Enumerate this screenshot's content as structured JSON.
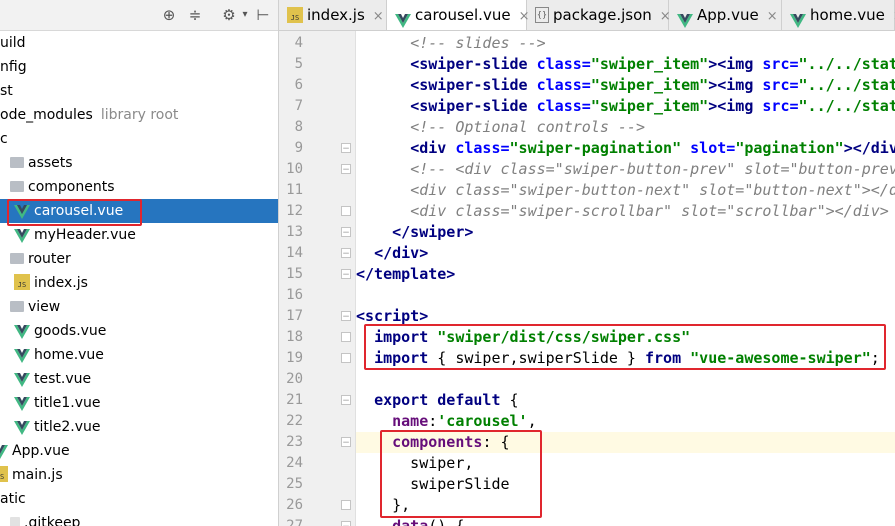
{
  "toolbar": {
    "icons": [
      "target-icon",
      "collapse-icon",
      "gear-icon",
      "pin-icon"
    ]
  },
  "tree": [
    {
      "label": "uild",
      "icon": "folder",
      "indent": 0
    },
    {
      "label": "nfig",
      "icon": "folder",
      "indent": 0
    },
    {
      "label": "st",
      "icon": "folder",
      "indent": 0
    },
    {
      "label": "ode_modules",
      "suffix": "library root",
      "icon": "folder",
      "indent": 0
    },
    {
      "label": "c",
      "icon": "folder",
      "indent": 0
    },
    {
      "label": "assets",
      "icon": "folder",
      "indent": 1
    },
    {
      "label": "components",
      "icon": "folder",
      "indent": 1
    },
    {
      "label": "carousel.vue",
      "icon": "vue",
      "indent": 2,
      "selected": true
    },
    {
      "label": "myHeader.vue",
      "icon": "vue",
      "indent": 2
    },
    {
      "label": "router",
      "icon": "folder",
      "indent": 1
    },
    {
      "label": "index.js",
      "icon": "js",
      "indent": 2
    },
    {
      "label": "view",
      "icon": "folder",
      "indent": 1
    },
    {
      "label": "goods.vue",
      "icon": "vue",
      "indent": 2
    },
    {
      "label": "home.vue",
      "icon": "vue",
      "indent": 2
    },
    {
      "label": "test.vue",
      "icon": "vue",
      "indent": 2
    },
    {
      "label": "title1.vue",
      "icon": "vue",
      "indent": 2
    },
    {
      "label": "title2.vue",
      "icon": "vue",
      "indent": 2
    },
    {
      "label": "App.vue",
      "icon": "vue",
      "indent": 0
    },
    {
      "label": "main.js",
      "icon": "js",
      "indent": 0
    },
    {
      "label": "atic",
      "icon": "folder",
      "indent": 0
    },
    {
      "label": ".gitkeep",
      "icon": "file",
      "indent": 1
    }
  ],
  "tabs": [
    {
      "label": "index.js",
      "icon": "js",
      "active": false
    },
    {
      "label": "carousel.vue",
      "icon": "vue",
      "active": true
    },
    {
      "label": "package.json",
      "icon": "json",
      "active": false
    },
    {
      "label": "App.vue",
      "icon": "vue",
      "active": false
    },
    {
      "label": "home.vue",
      "icon": "vue",
      "active": false
    }
  ],
  "tab_close": "×",
  "code_lines": [
    {
      "n": "4",
      "tokens": [
        [
          "plain",
          "      "
        ],
        [
          "cmt",
          "<!-- slides -->"
        ]
      ]
    },
    {
      "n": "5",
      "tokens": [
        [
          "plain",
          "      "
        ],
        [
          "tag",
          "<swiper-slide "
        ],
        [
          "attr",
          "class="
        ],
        [
          "str",
          "\"swiper_item\""
        ],
        [
          "tag",
          ">"
        ],
        [
          "tag",
          "<img "
        ],
        [
          "attr",
          "src="
        ],
        [
          "str",
          "\"../../static/"
        ]
      ]
    },
    {
      "n": "6",
      "tokens": [
        [
          "plain",
          "      "
        ],
        [
          "tag",
          "<swiper-slide "
        ],
        [
          "attr",
          "class="
        ],
        [
          "str",
          "\"swiper_item\""
        ],
        [
          "tag",
          ">"
        ],
        [
          "tag",
          "<img "
        ],
        [
          "attr",
          "src="
        ],
        [
          "str",
          "\"../../static/"
        ]
      ]
    },
    {
      "n": "7",
      "tokens": [
        [
          "plain",
          "      "
        ],
        [
          "tag",
          "<swiper-slide "
        ],
        [
          "attr",
          "class="
        ],
        [
          "str",
          "\"swiper_item\""
        ],
        [
          "tag",
          ">"
        ],
        [
          "tag",
          "<img "
        ],
        [
          "attr",
          "src="
        ],
        [
          "str",
          "\"../../static/"
        ]
      ]
    },
    {
      "n": "8",
      "tokens": [
        [
          "plain",
          "      "
        ],
        [
          "cmt",
          "<!-- Optional controls -->"
        ]
      ]
    },
    {
      "n": "9",
      "tokens": [
        [
          "plain",
          "      "
        ],
        [
          "tag",
          "<div "
        ],
        [
          "attr",
          "class="
        ],
        [
          "str",
          "\"swiper-pagination\""
        ],
        [
          "plain",
          " "
        ],
        [
          "attr",
          "slot="
        ],
        [
          "str",
          "\"pagination\""
        ],
        [
          "tag",
          "></div>"
        ]
      ]
    },
    {
      "n": "10",
      "tokens": [
        [
          "plain",
          "      "
        ],
        [
          "cmt",
          "<!-- <div class=\"swiper-button-prev\" slot=\"button-prev\"></div>"
        ]
      ]
    },
    {
      "n": "11",
      "tokens": [
        [
          "plain",
          "      "
        ],
        [
          "cmt",
          "<div class=\"swiper-button-next\" slot=\"button-next\"></div>"
        ]
      ]
    },
    {
      "n": "12",
      "tokens": [
        [
          "plain",
          "      "
        ],
        [
          "cmt",
          "<div class=\"swiper-scrollbar\" slot=\"scrollbar\"></div> -->"
        ]
      ]
    },
    {
      "n": "13",
      "tokens": [
        [
          "plain",
          "    "
        ],
        [
          "tag",
          "</swiper>"
        ]
      ]
    },
    {
      "n": "14",
      "tokens": [
        [
          "plain",
          "  "
        ],
        [
          "tag",
          "</div>"
        ]
      ]
    },
    {
      "n": "15",
      "tokens": [
        [
          "tag",
          "</template>"
        ]
      ]
    },
    {
      "n": "16",
      "tokens": []
    },
    {
      "n": "17",
      "tokens": [
        [
          "tag",
          "<script>"
        ]
      ]
    },
    {
      "n": "18",
      "tokens": [
        [
          "plain",
          "  "
        ],
        [
          "kw",
          "import "
        ],
        [
          "str",
          "\"swiper/dist/css/swiper.css\""
        ]
      ]
    },
    {
      "n": "19",
      "tokens": [
        [
          "plain",
          "  "
        ],
        [
          "kw",
          "import "
        ],
        [
          "plain",
          "{ swiper,swiperSlide } "
        ],
        [
          "kw",
          "from "
        ],
        [
          "str",
          "\"vue-awesome-swiper\""
        ],
        [
          "plain",
          ";"
        ]
      ]
    },
    {
      "n": "20",
      "tokens": []
    },
    {
      "n": "21",
      "tokens": [
        [
          "plain",
          "  "
        ],
        [
          "kw",
          "export default "
        ],
        [
          "plain",
          "{"
        ]
      ]
    },
    {
      "n": "22",
      "tokens": [
        [
          "plain",
          "    "
        ],
        [
          "prop",
          "name"
        ],
        [
          "plain",
          ":"
        ],
        [
          "str",
          "'carousel'"
        ],
        [
          "plain",
          ","
        ]
      ]
    },
    {
      "n": "23",
      "tokens": [
        [
          "plain",
          "    "
        ],
        [
          "prop",
          "components"
        ],
        [
          "plain",
          ": {"
        ]
      ]
    },
    {
      "n": "24",
      "tokens": [
        [
          "plain",
          "      swiper,"
        ]
      ]
    },
    {
      "n": "25",
      "tokens": [
        [
          "plain",
          "      swiperSlide"
        ]
      ]
    },
    {
      "n": "26",
      "tokens": [
        [
          "plain",
          "    },"
        ]
      ]
    },
    {
      "n": "27",
      "tokens": [
        [
          "plain",
          "    "
        ],
        [
          "prop",
          "data"
        ],
        [
          "plain",
          "() {"
        ]
      ]
    }
  ],
  "highlight_line": "23"
}
